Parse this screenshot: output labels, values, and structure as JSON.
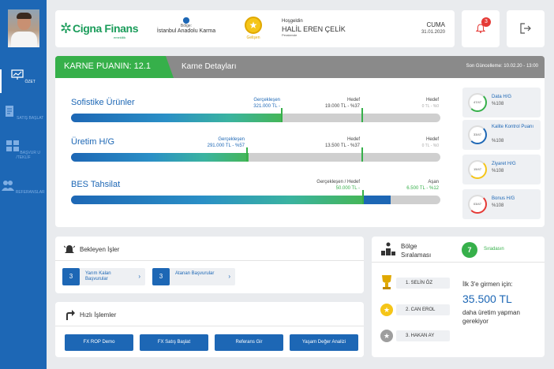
{
  "sidebar": {
    "items": [
      {
        "label": "ÖZET",
        "icon": "presentation-chart-icon",
        "active": true
      },
      {
        "label": "SATIŞ BAŞLAT",
        "icon": "document-icon"
      },
      {
        "label": "BAŞVUR U /TEKLİF",
        "icon": "grid-icon"
      },
      {
        "label": "REFERANSLAR",
        "icon": "people-icon"
      }
    ]
  },
  "header": {
    "logo_name": "Cigna Finans",
    "logo_tagline": "emeklilik",
    "region_label": "Bölge:",
    "region_value": "İstanbul Anadolu Karma",
    "level_label": "Gelişen",
    "welcome": "Hoşgeldin",
    "user_name": "HALİL EREN ÇELİK",
    "segment": "Perakende",
    "day": "CUMA",
    "date": "31.01.2020",
    "notification_count": "3"
  },
  "karne": {
    "score_label": "KARNE PUANIN: 12.1",
    "title": "Karne Detayları",
    "last_update": "Son Güncelleme: 10.02.20 - 13:00",
    "metrics": [
      {
        "name": "Sofistike Ürünler",
        "real_label": "Gerçekleşen",
        "real_value": "321.000 TL -",
        "target_label": "Hedef",
        "target_value": "19.000 TL - %37",
        "max_label": "Hedef",
        "max_value": "0 TL - %0",
        "fill_ratio": 0.57
      },
      {
        "name": "Üretim H/G",
        "real_label": "Gerçekleşen",
        "real_value": "291.000 TL - %57",
        "target_label": "Hedef",
        "target_value": "13.500 TL - %37",
        "max_label": "Hedef",
        "max_value": "0 TL - %0",
        "fill_ratio": 0.48
      },
      {
        "name": "BES Tahsilat",
        "real_label": "Gerçekleşen / Hedef",
        "real_value": "50.000 TL -",
        "over_label": "Aşan",
        "over_value": "6.500 TL - %12",
        "fill_ratio": 0.79,
        "over_ratio": 0.075
      }
    ],
    "stats": [
      {
        "ring": "47/47",
        "name": "Data H/G",
        "value": "%108",
        "color": "#36b04a"
      },
      {
        "ring": "33/47",
        "name": "Kalite Kontrol Puanı",
        "value": "%108",
        "color": "#1d67b5"
      },
      {
        "ring": "15/47",
        "name": "Ziyaret H/G",
        "value": "%108",
        "color": "#f5c518"
      },
      {
        "ring": "03/47",
        "name": "Bonus H/G",
        "value": "%108",
        "color": "#e53935"
      }
    ]
  },
  "pending": {
    "title": "Bekleyen İşler",
    "items": [
      {
        "count": "3",
        "label": "Yarım Kalan Başvurular"
      },
      {
        "count": "3",
        "label": "Atanan Başvurular"
      }
    ]
  },
  "quick": {
    "title": "Hızlı İşlemler",
    "buttons": [
      "FX ROP Demo",
      "FX Satış Başlat",
      "Referans Gir",
      "Yaşam Değer Analizi"
    ]
  },
  "region_rank": {
    "title": "Bölge Sıralaması",
    "rank": "7",
    "rank_word": "Sıradasın",
    "leaders": [
      {
        "name": "1. SELİN ÖZ",
        "medal": "gold"
      },
      {
        "name": "2. CAN EROL",
        "medal": "gold"
      },
      {
        "name": "3. HAKAN AY",
        "medal": "silver"
      }
    ],
    "need_line1": "İlk 3'e girmen için:",
    "need_amount": "35.500 TL",
    "need_line2": "daha üretim yapman gerekiyor"
  }
}
